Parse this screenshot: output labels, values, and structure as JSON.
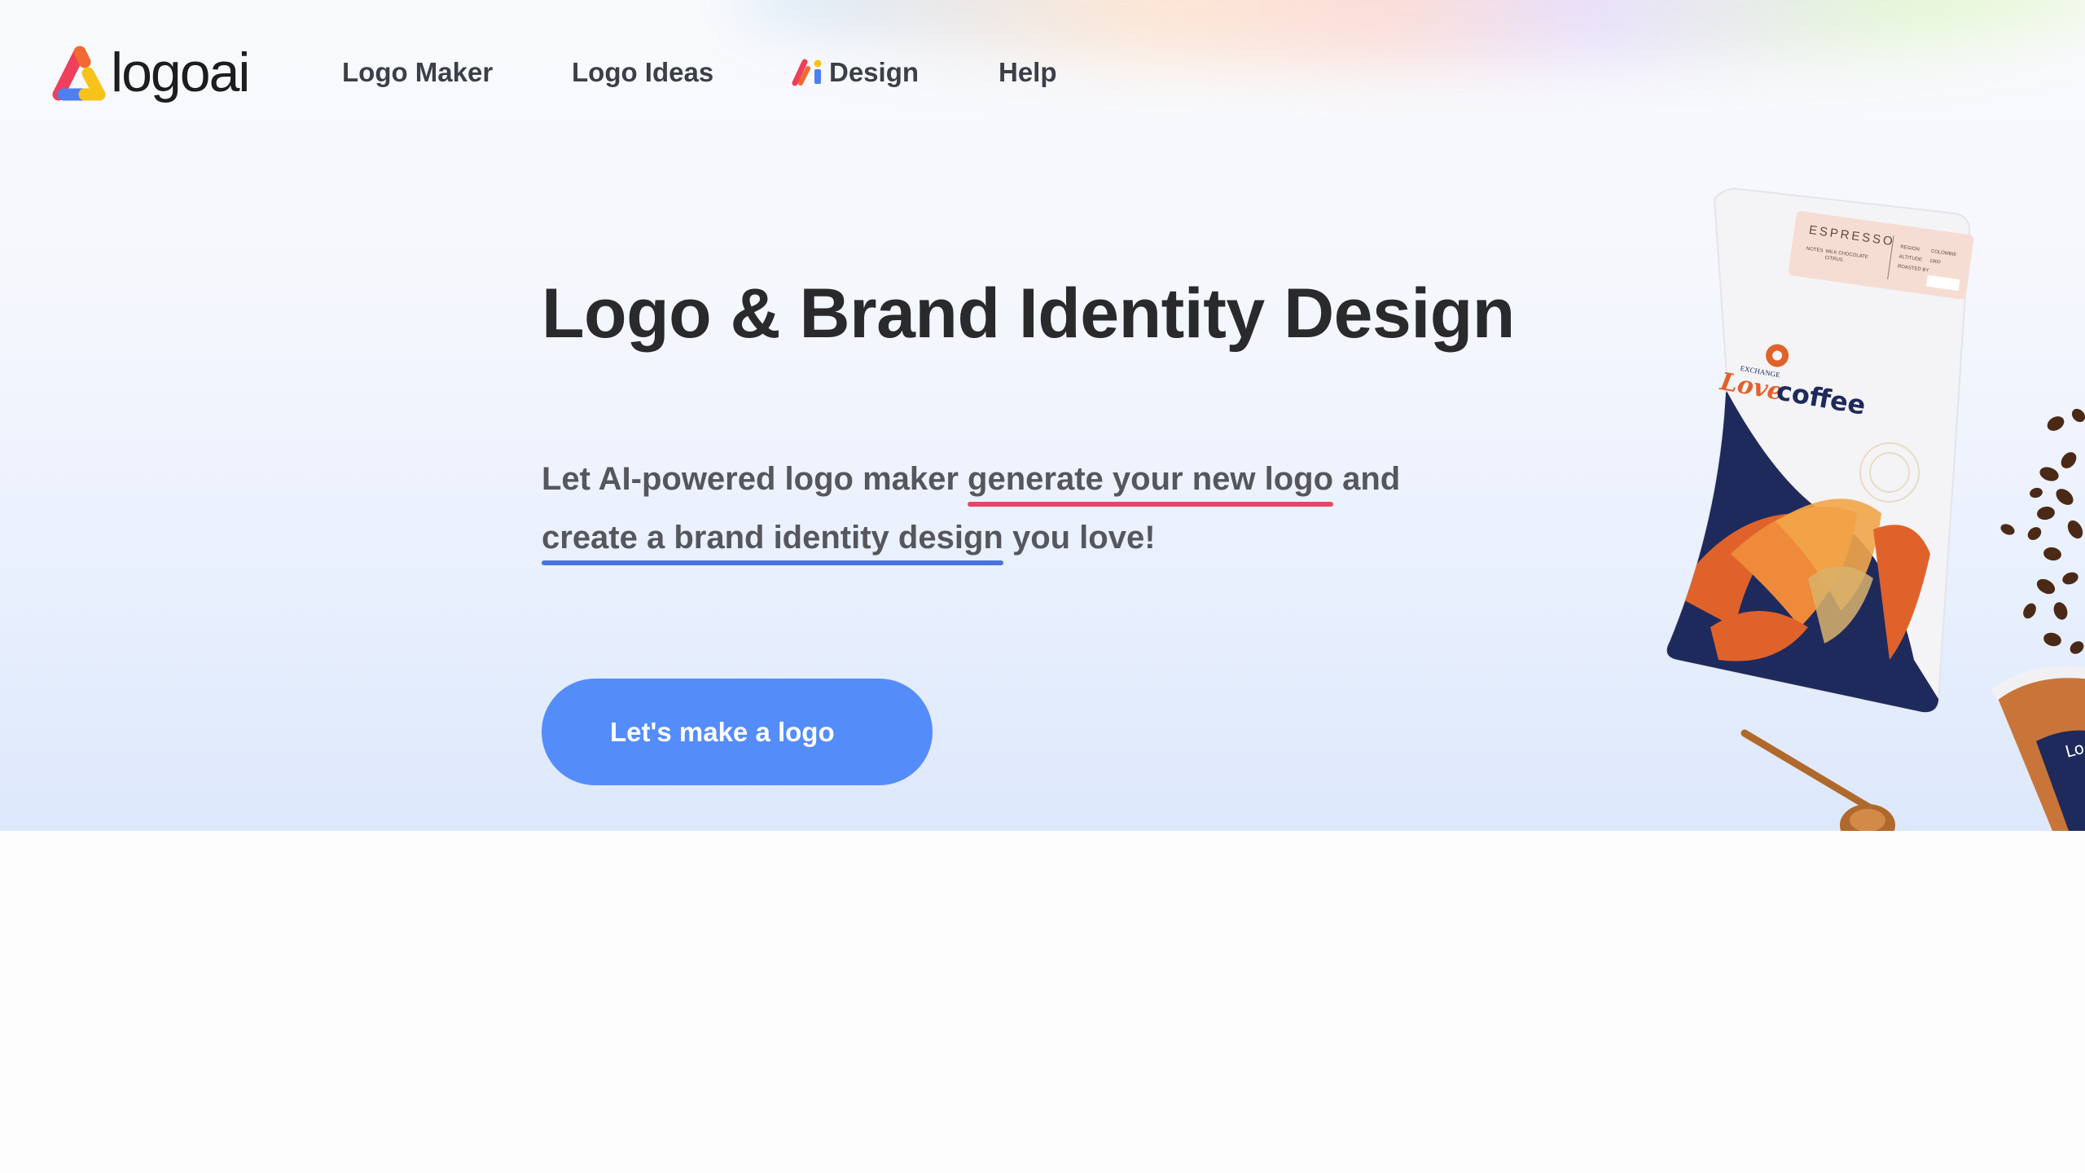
{
  "brand": {
    "name": "logoai"
  },
  "nav": {
    "items": [
      {
        "label": "Logo Maker"
      },
      {
        "label": "Logo Ideas"
      },
      {
        "label": "Design"
      },
      {
        "label": "Help"
      }
    ]
  },
  "hero": {
    "title": "Logo & Brand Identity Design",
    "sub_line1_prefix": "Let AI-powered logo maker ",
    "sub_line1_highlight": "generate your new logo",
    "sub_line1_suffix": " and",
    "sub_line2_highlight": "create a brand identity design",
    "sub_line2_suffix": " you love!",
    "cta_label": "Let's make a logo"
  },
  "illustration": {
    "bag_label_title": "ESPRESSO",
    "bag_label_small": [
      "NOTES",
      "MILK CHOCOLATE",
      "CITRUS",
      "REGION",
      "COLOMBIE",
      "ALTITUDE",
      "1900",
      "ROASTED BY"
    ],
    "bag_brand_top": "EXCHANGE",
    "bag_brand_love": "Love",
    "bag_brand_coffee": "coffee",
    "cup_text": "Lo"
  },
  "colors": {
    "accent_blue": "#548cfa",
    "underline_red": "#e94469",
    "underline_blue": "#4a73e0",
    "navy": "#1f2a5c",
    "orange": "#e0622b"
  }
}
